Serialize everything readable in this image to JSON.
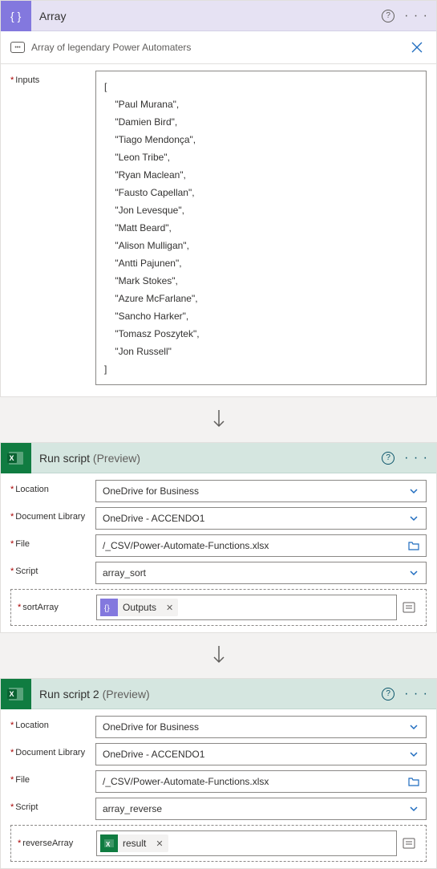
{
  "compose": {
    "title": "Array",
    "rename_text": "Array of legendary Power Automaters",
    "inputs_label": "Inputs",
    "inputs_value": "[\n    \"Paul Murana\",\n    \"Damien Bird\",\n    \"Tiago Mendonça\",\n    \"Leon Tribe\",\n    \"Ryan Maclean\",\n    \"Fausto Capellan\",\n    \"Jon Levesque\",\n    \"Matt Beard\",\n    \"Alison Mulligan\",\n    \"Antti Pajunen\",\n    \"Mark Stokes\",\n    \"Azure McFarlane\",\n    \"Sancho Harker\",\n    \"Tomasz Poszytek\",\n    \"Jon Russell\"\n]"
  },
  "run_script_1": {
    "title": "Run script",
    "preview": "(Preview)",
    "location_label": "Location",
    "location_value": "OneDrive for Business",
    "doclib_label": "Document Library",
    "doclib_value": "OneDrive - ACCENDO1",
    "file_label": "File",
    "file_value": "/_CSV/Power-Automate-Functions.xlsx",
    "script_label": "Script",
    "script_value": "array_sort",
    "param_label": "sortArray",
    "token_label": "Outputs"
  },
  "run_script_2": {
    "title": "Run script 2",
    "preview": "(Preview)",
    "location_label": "Location",
    "location_value": "OneDrive for Business",
    "doclib_label": "Document Library",
    "doclib_value": "OneDrive - ACCENDO1",
    "file_label": "File",
    "file_value": "/_CSV/Power-Automate-Functions.xlsx",
    "script_label": "Script",
    "script_value": "array_reverse",
    "param_label": "reverseArray",
    "token_label": "result"
  }
}
